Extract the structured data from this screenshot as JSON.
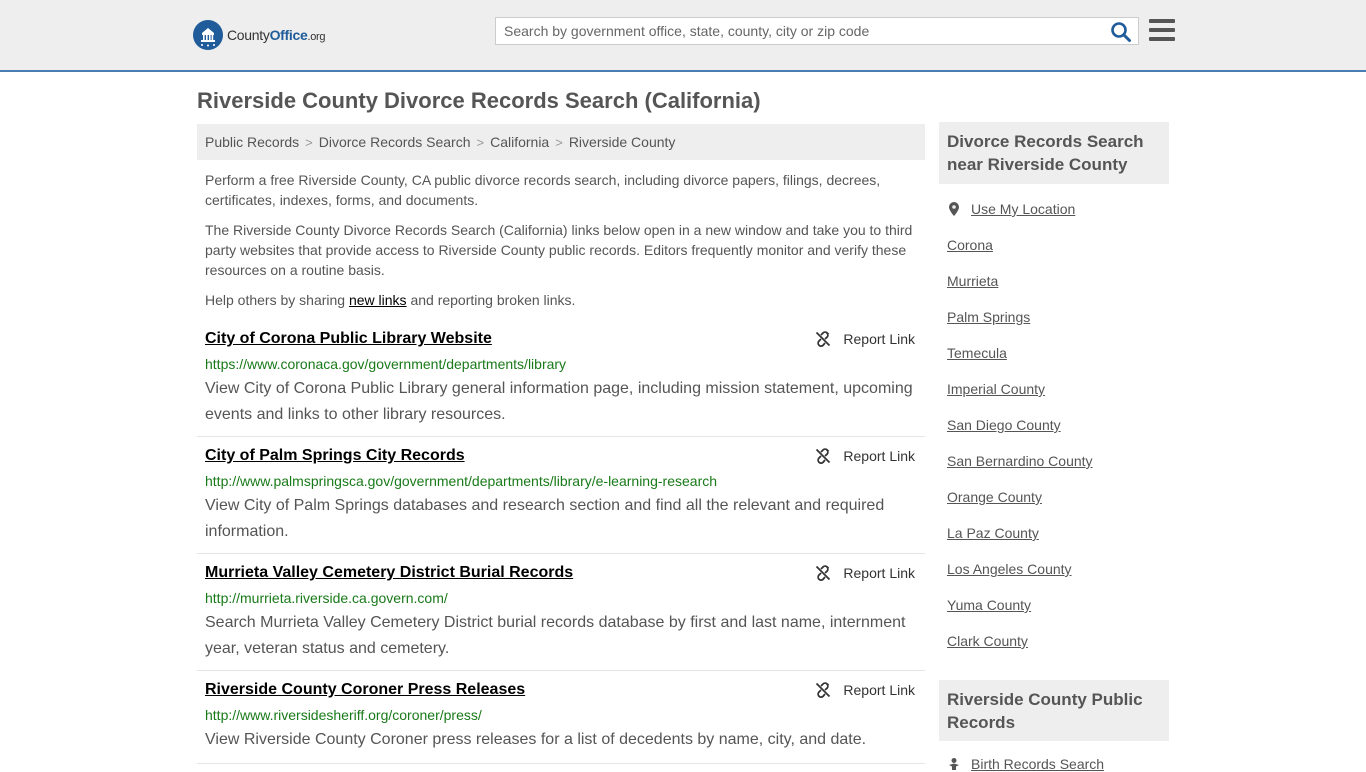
{
  "header": {
    "logo_main": "County",
    "logo_office": "Office",
    "logo_org": ".org",
    "search_placeholder": "Search by government office, state, county, city or zip code"
  },
  "page_title": "Riverside County Divorce Records Search (California)",
  "breadcrumb": [
    "Public Records",
    "Divorce Records Search",
    "California",
    "Riverside County"
  ],
  "intro": {
    "p1": "Perform a free Riverside County, CA public divorce records search, including divorce papers, filings, decrees, certificates, indexes, forms, and documents.",
    "p2": "The Riverside County Divorce Records Search (California) links below open in a new window and take you to third party websites that provide access to Riverside County public records. Editors frequently monitor and verify these resources on a routine basis.",
    "p3_before": "Help others by sharing ",
    "p3_link": "new links",
    "p3_after": " and reporting broken links."
  },
  "report_label": "Report Link",
  "results": [
    {
      "title": "City of Corona Public Library Website",
      "url": "https://www.coronaca.gov/government/departments/library",
      "desc": "View City of Corona Public Library general information page, including mission statement, upcoming events and links to other library resources."
    },
    {
      "title": "City of Palm Springs City Records",
      "url": "http://www.palmspringsca.gov/government/departments/library/e-learning-research",
      "desc": "View City of Palm Springs databases and research section and find all the relevant and required information."
    },
    {
      "title": "Murrieta Valley Cemetery District Burial Records",
      "url": "http://murrieta.riverside.ca.govern.com/",
      "desc": "Search Murrieta Valley Cemetery District burial records database by first and last name, internment year, veteran status and cemetery."
    },
    {
      "title": "Riverside County Coroner Press Releases",
      "url": "http://www.riversidesheriff.org/coroner/press/",
      "desc": "View Riverside County Coroner press releases for a list of decedents by name, city, and date."
    }
  ],
  "sidebar": {
    "nearby_title": "Divorce Records Search near Riverside County",
    "use_location": "Use My Location",
    "nearby": [
      "Corona",
      "Murrieta",
      "Palm Springs",
      "Temecula",
      "Imperial County",
      "San Diego County",
      "San Bernardino County",
      "Orange County",
      "La Paz County",
      "Los Angeles County",
      "Yuma County",
      "Clark County"
    ],
    "public_records_title": "Riverside County Public Records",
    "public_records": [
      "Birth Records Search"
    ]
  }
}
